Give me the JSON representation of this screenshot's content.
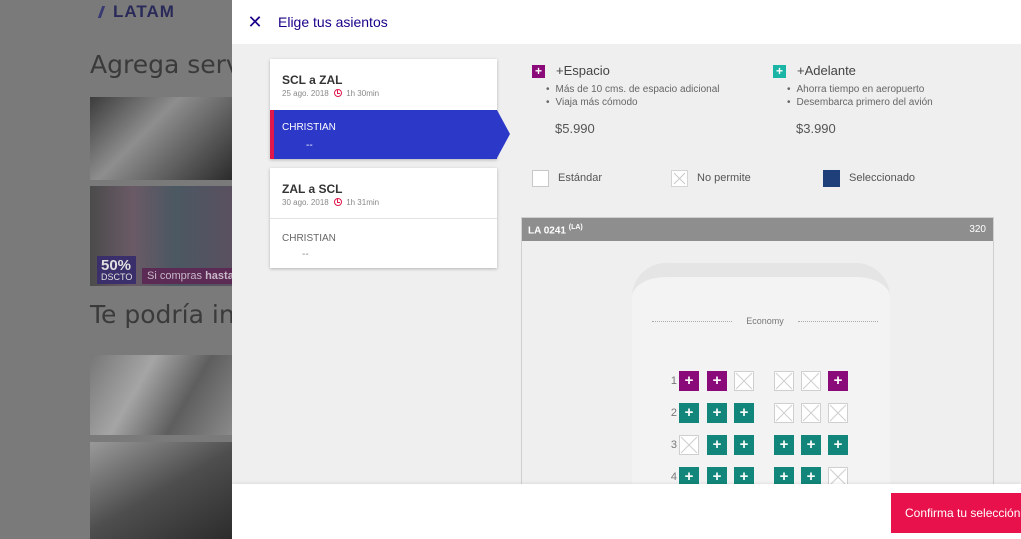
{
  "background_page": {
    "logo_text": "LATAM",
    "heading_services": "Agrega serv",
    "heading_maybe": "Te podría int",
    "promo": {
      "percent": "50%",
      "discount": "DSCTO",
      "text_prefix": "Si compras ",
      "text_bold": "hasta"
    }
  },
  "modal": {
    "title": "Elige tus asientos",
    "flights": [
      {
        "route": "SCL a ZAL",
        "date": "25 ago. 2018",
        "duration": "1h 30min",
        "passenger": "CHRISTIAN",
        "seat": "--"
      },
      {
        "route": "ZAL a SCL",
        "date": "30 ago. 2018",
        "duration": "1h 31min",
        "passenger": "CHRISTIAN",
        "seat": "--"
      }
    ],
    "options": [
      {
        "title": "+Espacio",
        "bullets": [
          "Más de 10 cms. de espacio adicional",
          "Viaja más cómodo"
        ],
        "price": "$5.990",
        "color": "#8b0a7a"
      },
      {
        "title": "+Adelante",
        "bullets": [
          "Ahorra tiempo en aeropuerto",
          "Desembarca primero del avión"
        ],
        "price": "$3.990",
        "color": "#1bb5a6"
      }
    ],
    "legend": {
      "standard": "Estándar",
      "not_allowed": "No permite",
      "selected": "Seleccionado"
    },
    "seatmap": {
      "flight_code": "LA 0241",
      "carrier_sup": "(LA)",
      "aircraft": "320",
      "cabin": "Economy",
      "rows": [
        {
          "number": "1",
          "seats": [
            "espacio",
            "espacio",
            "blocked",
            "blocked",
            "blocked",
            "espacio"
          ]
        },
        {
          "number": "2",
          "seats": [
            "adelante",
            "adelante",
            "adelante",
            "blocked",
            "blocked",
            "blocked"
          ]
        },
        {
          "number": "3",
          "seats": [
            "blocked",
            "adelante",
            "adelante",
            "adelante",
            "adelante",
            "adelante"
          ]
        },
        {
          "number": "4",
          "seats": [
            "adelante",
            "adelante",
            "adelante",
            "adelante",
            "adelante",
            "blocked"
          ]
        }
      ]
    },
    "confirm_label": "Confirma tu selección"
  },
  "colors": {
    "brand_blue": "#1b0088",
    "active_passenger": "#2c38c8",
    "confirm": "#e8114b",
    "espacio": "#8b0a7a",
    "adelante": "#12867a",
    "selected": "#1e3f7a"
  },
  "icons": {
    "close": "close-icon",
    "clock": "clock-icon",
    "plus": "plus-icon",
    "blocked_seat": "x-seat-icon"
  }
}
